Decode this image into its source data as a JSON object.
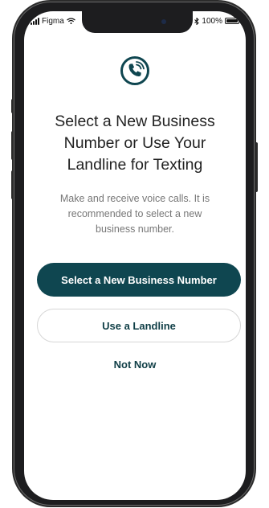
{
  "status_bar": {
    "carrier": "Figma",
    "battery_percent": "100%",
    "icons": [
      "signal-icon",
      "wifi-icon",
      "bluetooth-icon",
      "battery-icon"
    ]
  },
  "header_icon": "phone-call-icon",
  "title": "Select a New Business\nNumber or Use Your\nLandline for Texting",
  "subtitle": "Make and receive voice calls. It is\nrecommended to select a new\nbusiness number.",
  "actions": {
    "primary_label": "Select a New Business Number",
    "secondary_label": "Use a Landline",
    "tertiary_label": "Not Now"
  },
  "colors": {
    "accent": "#0f4650",
    "text_dark": "#222222",
    "text_muted": "#777777"
  }
}
